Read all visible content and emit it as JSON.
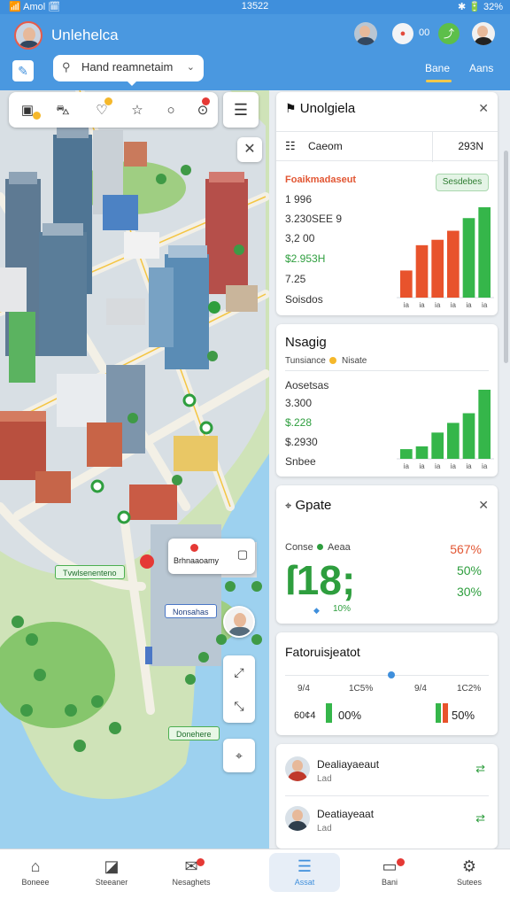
{
  "status_bar": {
    "left": "📶 Amol 🗓",
    "time": "13522",
    "right": "✱ 🔋 32%"
  },
  "header": {
    "app_title": "Unlehelca",
    "count": "00",
    "tabs": [
      {
        "label": "Bane"
      },
      {
        "label": "Aans"
      }
    ],
    "search": {
      "value": "Hand reamnetaim",
      "placeholder": "Search"
    }
  },
  "map": {
    "tags": [
      {
        "label": "Tvwlsenenteno"
      },
      {
        "label": "Nonsahas"
      },
      {
        "label": "Donehere"
      }
    ],
    "popup_text": "Brhnaaoamy"
  },
  "cards": {
    "card1": {
      "title": "Unolgiela",
      "row_label": "Caeom",
      "row_value": "293N",
      "heading": "Foaikmadaseut",
      "button": "Sesdebes",
      "values": [
        "1 996",
        "3.230SEE 9",
        "3,2 00",
        "$2.953H",
        "7.25",
        "Soisdos"
      ],
      "chart_data": {
        "type": "bar",
        "categories": [
          "ia",
          "ia",
          "ia",
          "ia",
          "ia",
          "ia"
        ],
        "values": [
          30,
          58,
          64,
          74,
          88,
          100
        ],
        "colors": [
          "#e8532c",
          "#e8532c",
          "#e8532c",
          "#e8532c",
          "#35b64a",
          "#35b64a"
        ]
      }
    },
    "card2": {
      "title": "Nsagig",
      "subtitle_left": "Tunsiance",
      "subtitle_right": "Nisate",
      "values": [
        "Aosetsas",
        "3.300",
        "$.228",
        "$.2930",
        "Snbee"
      ],
      "chart_data": {
        "type": "bar",
        "categories": [
          "ia",
          "ia",
          "ia",
          "ia",
          "ia",
          "ia"
        ],
        "values": [
          14,
          18,
          38,
          52,
          66,
          100
        ],
        "colors": [
          "#35b64a",
          "#35b64a",
          "#35b64a",
          "#35b64a",
          "#35b64a",
          "#35b64a"
        ]
      }
    },
    "card3": {
      "title": "Gpate",
      "left_label": "Conse",
      "left_label2": "Aeaa",
      "big_number": "ſ18;",
      "small_value": "10%",
      "right_values": [
        "567%",
        "50%",
        "30%"
      ]
    },
    "card4": {
      "title": "Fatoruisjeatot",
      "cols": [
        "9/4",
        "1C5%",
        "9/4",
        "1C2%"
      ],
      "left_value": "60¢4",
      "left_pct": "00%",
      "right_pct": "50%"
    },
    "list": [
      {
        "name": "Dealiayaeaut",
        "sub": "Lad"
      },
      {
        "name": "Deatiayeaat",
        "sub": "Lad"
      }
    ]
  },
  "bottom_nav": [
    {
      "label": "Boneee"
    },
    {
      "label": "Steeaner"
    },
    {
      "label": "Nesaghets"
    },
    {
      "label": "Assat"
    },
    {
      "label": "Bani"
    },
    {
      "label": "Sutees"
    }
  ]
}
